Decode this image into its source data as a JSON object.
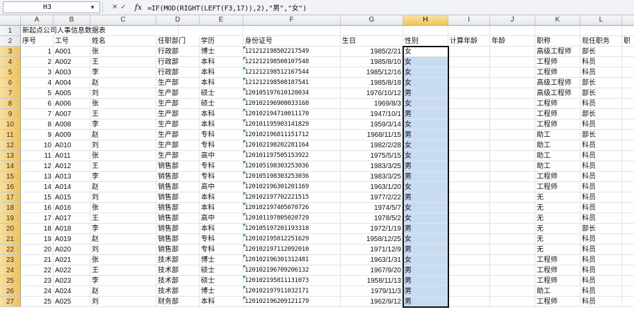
{
  "formula_bar": {
    "name_box": "H3",
    "fx": "fx",
    "formula": "=IF(MOD(RIGHT(LEFT(F3,17)),2),\"男\",\"女\")"
  },
  "columns": [
    "A",
    "B",
    "C",
    "D",
    "E",
    "F",
    "G",
    "H",
    "I",
    "J",
    "K",
    "L",
    ""
  ],
  "selected_column": "H",
  "title": "新起点公司人事信息数据表",
  "headers": [
    "序号",
    "工号",
    "姓名",
    "任职部门",
    "学历",
    "身份证号",
    "生日",
    "性别",
    "计算年龄",
    "年龄",
    "职称",
    "现任职务",
    "职"
  ],
  "rows": [
    {
      "n": "1",
      "id": "A001",
      "name": "张",
      "dept": "行政部",
      "edu": "博士",
      "idc": "121212198502217549",
      "bd": "1985/2/21",
      "g": "女",
      "title": "高级工程师",
      "pos": "部长"
    },
    {
      "n": "2",
      "id": "A002",
      "name": "王",
      "dept": "行政部",
      "edu": "本科",
      "idc": "121212198508107548",
      "bd": "1985/8/10",
      "g": "女",
      "title": "工程师",
      "pos": "科员"
    },
    {
      "n": "3",
      "id": "A003",
      "name": "李",
      "dept": "行政部",
      "edu": "本科",
      "idc": "121212198512167544",
      "bd": "1985/12/16",
      "g": "女",
      "title": "工程师",
      "pos": "科员"
    },
    {
      "n": "4",
      "id": "A004",
      "name": "赵",
      "dept": "生产部",
      "edu": "本科",
      "idc": "121212198508187541",
      "bd": "1985/8/18",
      "g": "女",
      "title": "高级工程师",
      "pos": "部长"
    },
    {
      "n": "5",
      "id": "A005",
      "name": "刘",
      "dept": "生产部",
      "edu": "硕士",
      "idc": "120105197610120034",
      "bd": "1976/10/12",
      "g": "男",
      "title": "高级工程师",
      "pos": "部长"
    },
    {
      "n": "6",
      "id": "A006",
      "name": "张",
      "dept": "生产部",
      "edu": "硕士",
      "idc": "120102196908033168",
      "bd": "1969/8/3",
      "g": "女",
      "title": "工程师",
      "pos": "科员"
    },
    {
      "n": "7",
      "id": "A007",
      "name": "王",
      "dept": "生产部",
      "edu": "本科",
      "idc": "120102194710011170",
      "bd": "1947/10/1",
      "g": "男",
      "title": "工程师",
      "pos": "部长"
    },
    {
      "n": "8",
      "id": "A008",
      "name": "李",
      "dept": "生产部",
      "edu": "本科",
      "idc": "120101195903141829",
      "bd": "1959/3/14",
      "g": "女",
      "title": "工程师",
      "pos": "科员"
    },
    {
      "n": "9",
      "id": "A009",
      "name": "赵",
      "dept": "生产部",
      "edu": "专科",
      "idc": "120102196811151712",
      "bd": "1968/11/15",
      "g": "男",
      "title": "助工",
      "pos": "部长"
    },
    {
      "n": "10",
      "id": "A010",
      "name": "刘",
      "dept": "生产部",
      "edu": "专科",
      "idc": "120102198202281164",
      "bd": "1982/2/28",
      "g": "女",
      "title": "助工",
      "pos": "科员"
    },
    {
      "n": "11",
      "id": "A011",
      "name": "张",
      "dept": "生产部",
      "edu": "高中",
      "idc": "120101197505153922",
      "bd": "1975/5/15",
      "g": "女",
      "title": "助工",
      "pos": "科员"
    },
    {
      "n": "12",
      "id": "A012",
      "name": "王",
      "dept": "销售部",
      "edu": "专科",
      "idc": "120105198303253036",
      "bd": "1983/3/25",
      "g": "男",
      "title": "助工",
      "pos": "科员"
    },
    {
      "n": "13",
      "id": "A013",
      "name": "李",
      "dept": "销售部",
      "edu": "专科",
      "idc": "120105198303253036",
      "bd": "1983/3/25",
      "g": "男",
      "title": "工程师",
      "pos": "科员"
    },
    {
      "n": "14",
      "id": "A014",
      "name": "赵",
      "dept": "销售部",
      "edu": "高中",
      "idc": "120102196301201169",
      "bd": "1963/1/20",
      "g": "女",
      "title": "工程师",
      "pos": "科员"
    },
    {
      "n": "15",
      "id": "A015",
      "name": "刘",
      "dept": "销售部",
      "edu": "本科",
      "idc": "120102197702221515",
      "bd": "1977/2/22",
      "g": "男",
      "title": "无",
      "pos": "科员"
    },
    {
      "n": "16",
      "id": "A016",
      "name": "张",
      "dept": "销售部",
      "edu": "本科",
      "idc": "120102197405070726",
      "bd": "1974/5/7",
      "g": "女",
      "title": "无",
      "pos": "科员"
    },
    {
      "n": "17",
      "id": "A017",
      "name": "王",
      "dept": "销售部",
      "edu": "高中",
      "idc": "120101197805020729",
      "bd": "1978/5/2",
      "g": "女",
      "title": "无",
      "pos": "科员"
    },
    {
      "n": "18",
      "id": "A018",
      "name": "李",
      "dept": "销售部",
      "edu": "本科",
      "idc": "120105197201193318",
      "bd": "1972/1/19",
      "g": "男",
      "title": "无",
      "pos": "部长"
    },
    {
      "n": "19",
      "id": "A019",
      "name": "赵",
      "dept": "销售部",
      "edu": "专科",
      "idc": "120102195812251629",
      "bd": "1958/12/25",
      "g": "女",
      "title": "无",
      "pos": "科员"
    },
    {
      "n": "20",
      "id": "A020",
      "name": "刘",
      "dept": "销售部",
      "edu": "专科",
      "idc": "120102197112092010",
      "bd": "1971/12/9",
      "g": "男",
      "title": "无",
      "pos": "科员"
    },
    {
      "n": "21",
      "id": "A021",
      "name": "张",
      "dept": "技术部",
      "edu": "博士",
      "idc": "120102196301312481",
      "bd": "1963/1/31",
      "g": "女",
      "title": "工程师",
      "pos": "科员"
    },
    {
      "n": "22",
      "id": "A022",
      "name": "王",
      "dept": "技术部",
      "edu": "硕士",
      "idc": "120102196709206132",
      "bd": "1967/9/20",
      "g": "男",
      "title": "工程师",
      "pos": "科员"
    },
    {
      "n": "23",
      "id": "A023",
      "name": "李",
      "dept": "技术部",
      "edu": "硕士",
      "idc": "120102195811131073",
      "bd": "1958/11/13",
      "g": "男",
      "title": "工程师",
      "pos": "科员"
    },
    {
      "n": "24",
      "id": "A024",
      "name": "赵",
      "dept": "技术部",
      "edu": "博士",
      "idc": "120102197911032171",
      "bd": "1979/11/3",
      "g": "男",
      "title": "助工",
      "pos": "科员"
    },
    {
      "n": "25",
      "id": "A025",
      "name": "刘",
      "dept": "财务部",
      "edu": "本科",
      "idc": "120102196209121179",
      "bd": "1962/9/12",
      "g": "男",
      "title": "工程师",
      "pos": "科员"
    }
  ]
}
